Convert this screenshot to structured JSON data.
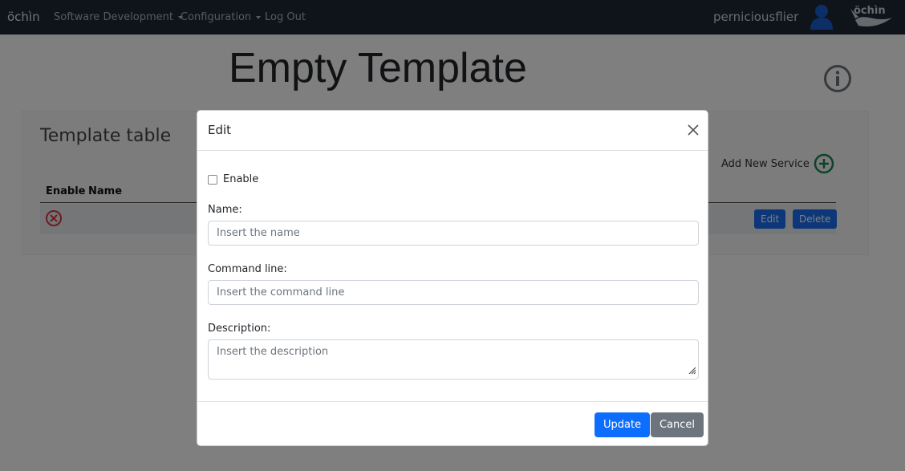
{
  "navbar": {
    "brand": "öchìn",
    "menu": [
      {
        "label": "Software Development"
      },
      {
        "label": "Configuration"
      },
      {
        "label": "Log Out"
      }
    ],
    "username": "perniciousflier",
    "logo_text": "öchìn"
  },
  "page": {
    "title": "Empty Template",
    "card_title": "Template table",
    "add_service_label": "Add New Service",
    "table": {
      "columns": [
        "Enable",
        "Name"
      ],
      "rows": [
        {
          "enabled": false,
          "name": "",
          "edit_label": "Edit",
          "delete_label": "Delete"
        }
      ]
    }
  },
  "modal": {
    "title": "Edit",
    "enable_label": "Enable",
    "enable_checked": false,
    "name_label": "Name:",
    "name_placeholder": "Insert the name",
    "command_label": "Command line:",
    "command_placeholder": "Insert the command line",
    "description_label": "Description:",
    "description_placeholder": "Insert the description",
    "update_label": "Update",
    "cancel_label": "Cancel"
  },
  "colors": {
    "navbar_bg": "#1f2937",
    "primary": "#0d6efd",
    "secondary": "#6c757d",
    "add_icon": "#198754",
    "disabled_icon": "#dc3545"
  },
  "icons": [
    "user-avatar-icon",
    "info-icon",
    "add-circle-icon",
    "disabled-circle-x-icon",
    "close-icon"
  ]
}
